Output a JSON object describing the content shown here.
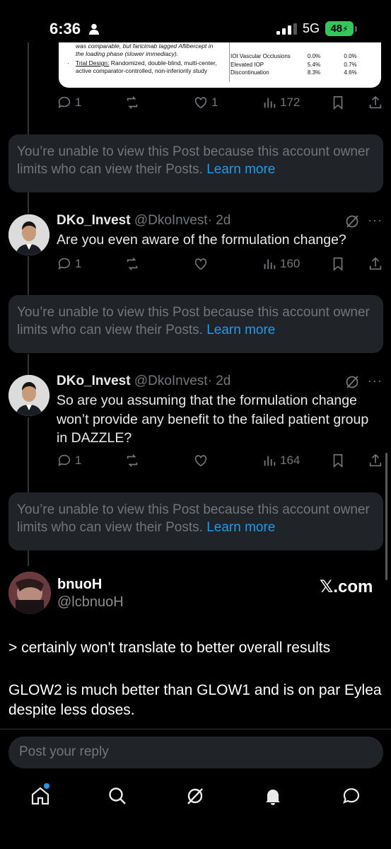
{
  "status_bar": {
    "time": "6:36",
    "network": "5G",
    "battery": "48"
  },
  "image_card": {
    "left_lines_italic": [
      "was comparable, but faricimab lagged Aflibercept in",
      "the loading phase (slower immediacy)."
    ],
    "trial_design_label": "Trial Design:",
    "trial_design_text": "Randomized, double-blind, multi-center,",
    "trial_design_text2": "active comparator-controlled, non-inferiority study",
    "rows": [
      {
        "label": "IOI Vascular Occlusions",
        "a": "0.0%",
        "b": "0.0%"
      },
      {
        "label": "Elevated IOP",
        "a": "5.4%",
        "b": "0.7%"
      },
      {
        "label": "Discontinuation",
        "a": "8.3%",
        "b": "4.6%"
      }
    ]
  },
  "top_actions": {
    "replies": "1",
    "likes": "1",
    "views": "172"
  },
  "restricted": {
    "text": "You’re unable to view this Post because this account owner limits who can view their Posts.",
    "link": "Learn more"
  },
  "tweets": [
    {
      "name": "DKo_Invest",
      "handle": "@DkoInvest",
      "time": "· 2d",
      "text": "Are you even aware of the formulation change?",
      "replies": "1",
      "views": "160"
    },
    {
      "name": "DKo_Invest",
      "handle": "@DkoInvest",
      "time": "· 2d",
      "text": "So are you assuming that the formulation change won’t provide any benefit to the failed patient group in DAZZLE?",
      "replies": "1",
      "views": "164"
    }
  ],
  "share": {
    "name": "bnuoH",
    "handle": "@lcbnuoH",
    "brand": "𝕏.com",
    "line1": "> certainly won't translate to better overall results",
    "line2": "GLOW2 is much better than GLOW1 and is on par Eylea despite less doses."
  },
  "reply": {
    "placeholder": "Post your reply"
  },
  "nav": [
    "home-icon",
    "search-icon",
    "grok-icon",
    "notifications-icon",
    "messages-icon"
  ]
}
